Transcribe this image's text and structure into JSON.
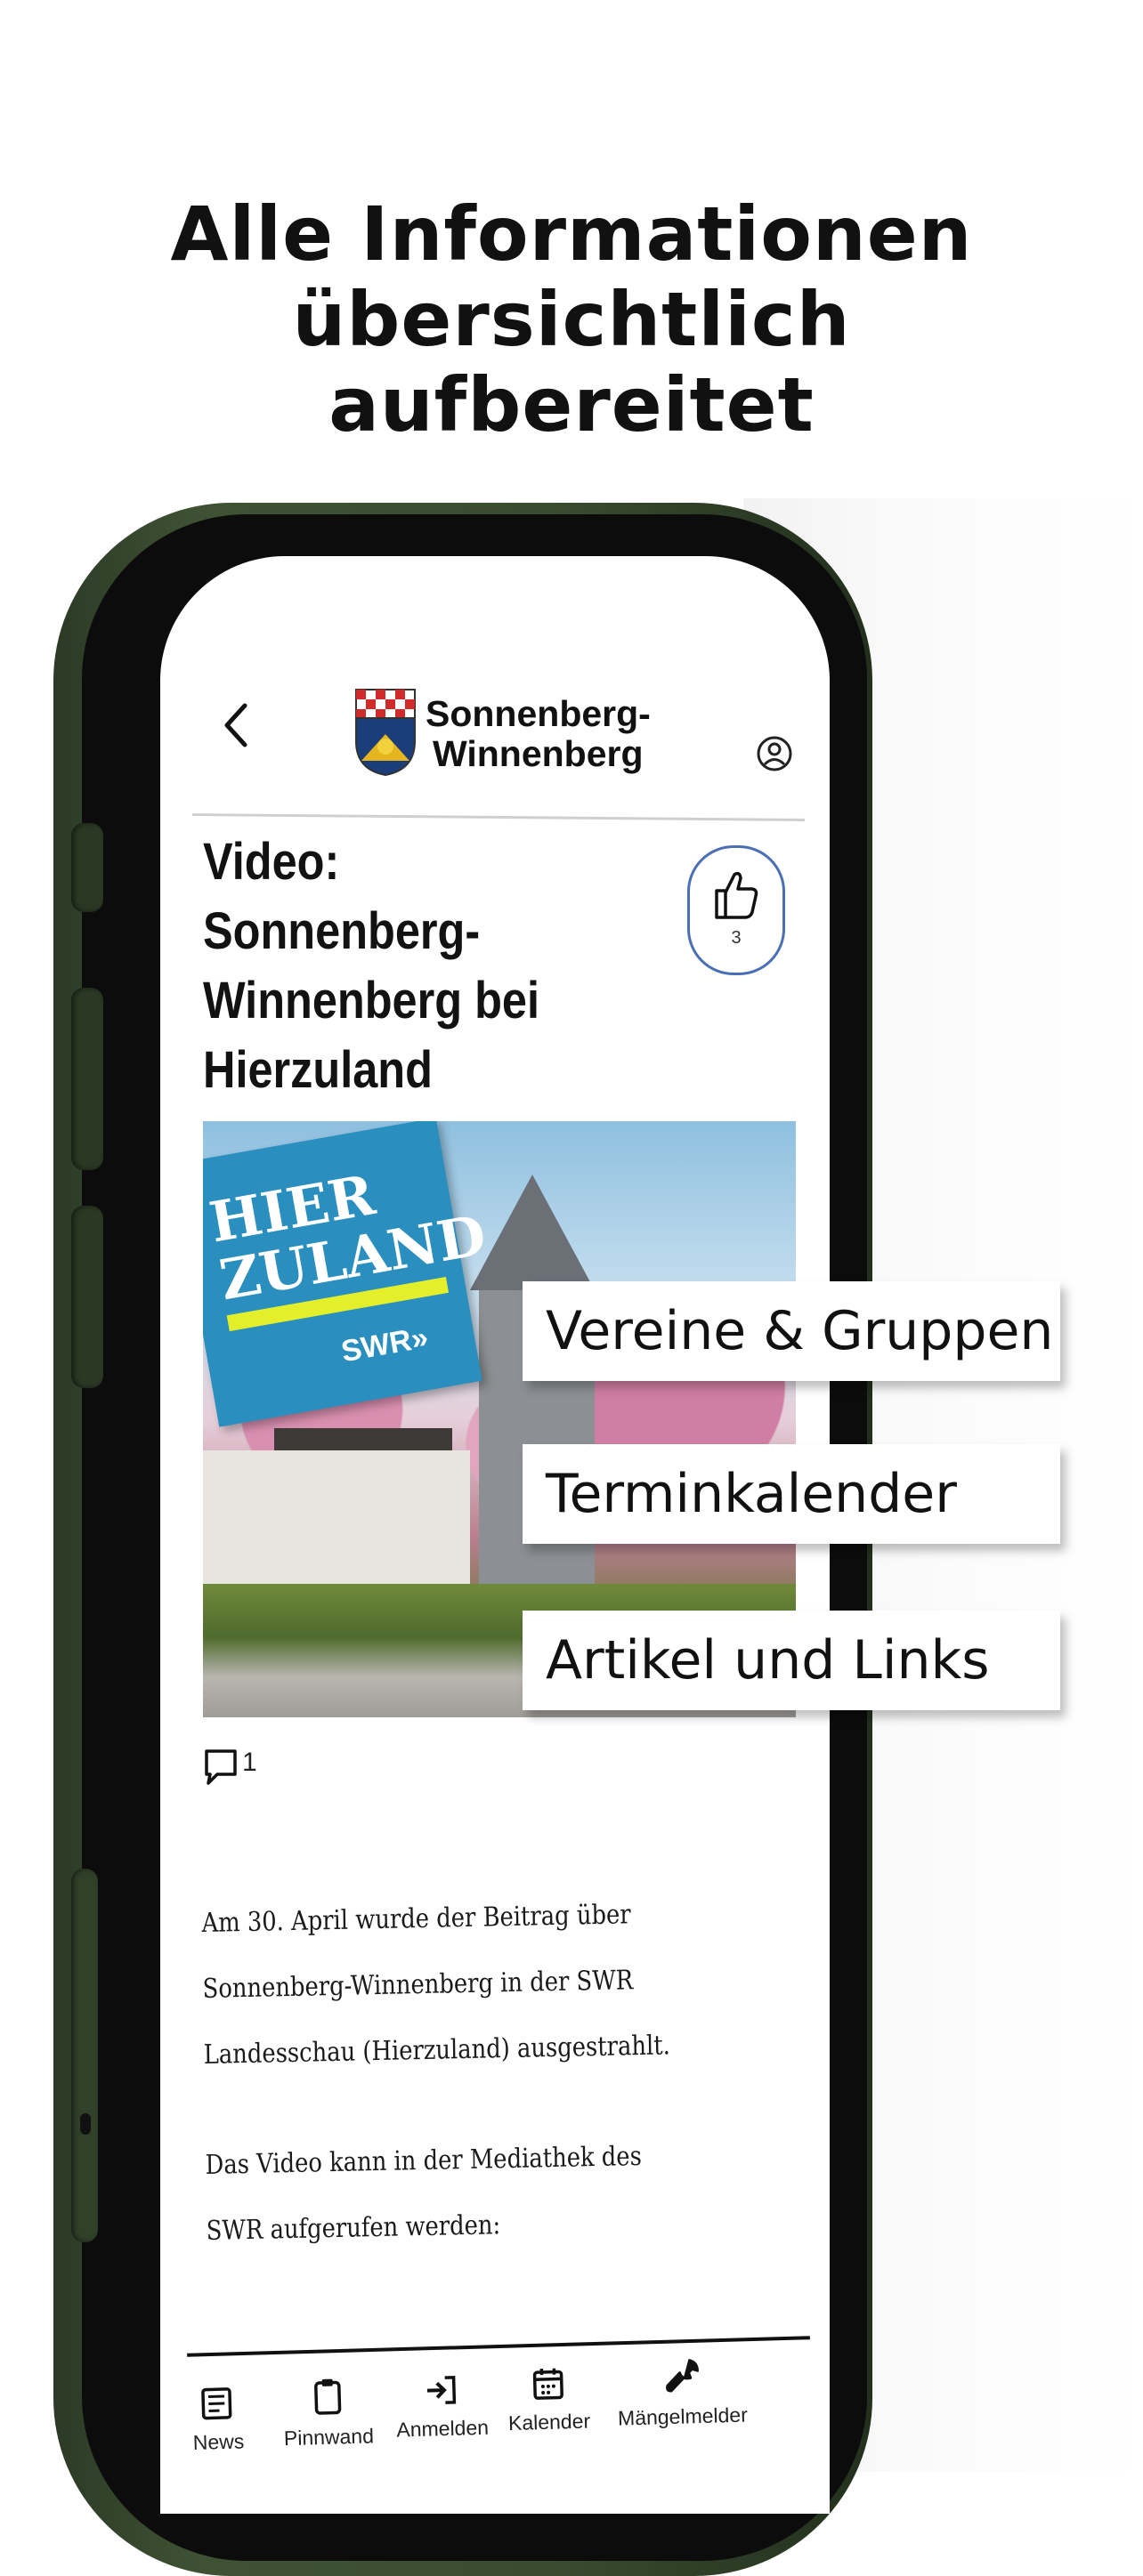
{
  "headline": [
    "Alle Informationen",
    "übersichtlich",
    "aufbereitet"
  ],
  "app": {
    "brand_line1": "Sonnenberg-",
    "brand_line2": "Winnenberg"
  },
  "article": {
    "title": "Video: Sonnenberg-Winnenberg bei Hierzuland",
    "likes": "3",
    "comments": "1",
    "image_sign": {
      "line1": "HIER",
      "line2": "ZULAND",
      "logo": "SWR»"
    },
    "paragraphs": [
      "Am 30. April wurde der Beitrag über Sonnenberg-Winnenberg in der SWR Landesschau (Hierzuland) ausgestrahlt.",
      "Das Video kann in der Mediathek des SWR aufgerufen werden:"
    ]
  },
  "tabs": [
    {
      "label": "News",
      "icon": "newspaper-icon"
    },
    {
      "label": "Pinnwand",
      "icon": "clipboard-icon"
    },
    {
      "label": "Anmelden",
      "icon": "login-icon"
    },
    {
      "label": "Kalender",
      "icon": "calendar-icon"
    },
    {
      "label": "Mängelmelder",
      "icon": "wrench-icon"
    }
  ],
  "callouts": [
    "Vereine & Gruppen",
    "Terminkalender",
    "Artikel und Links"
  ],
  "colors": {
    "phone": "#3e5233",
    "accent": "#4a6fb5",
    "sign_blue": "#2a8fbf",
    "sign_yellow": "#e3ef2a"
  }
}
